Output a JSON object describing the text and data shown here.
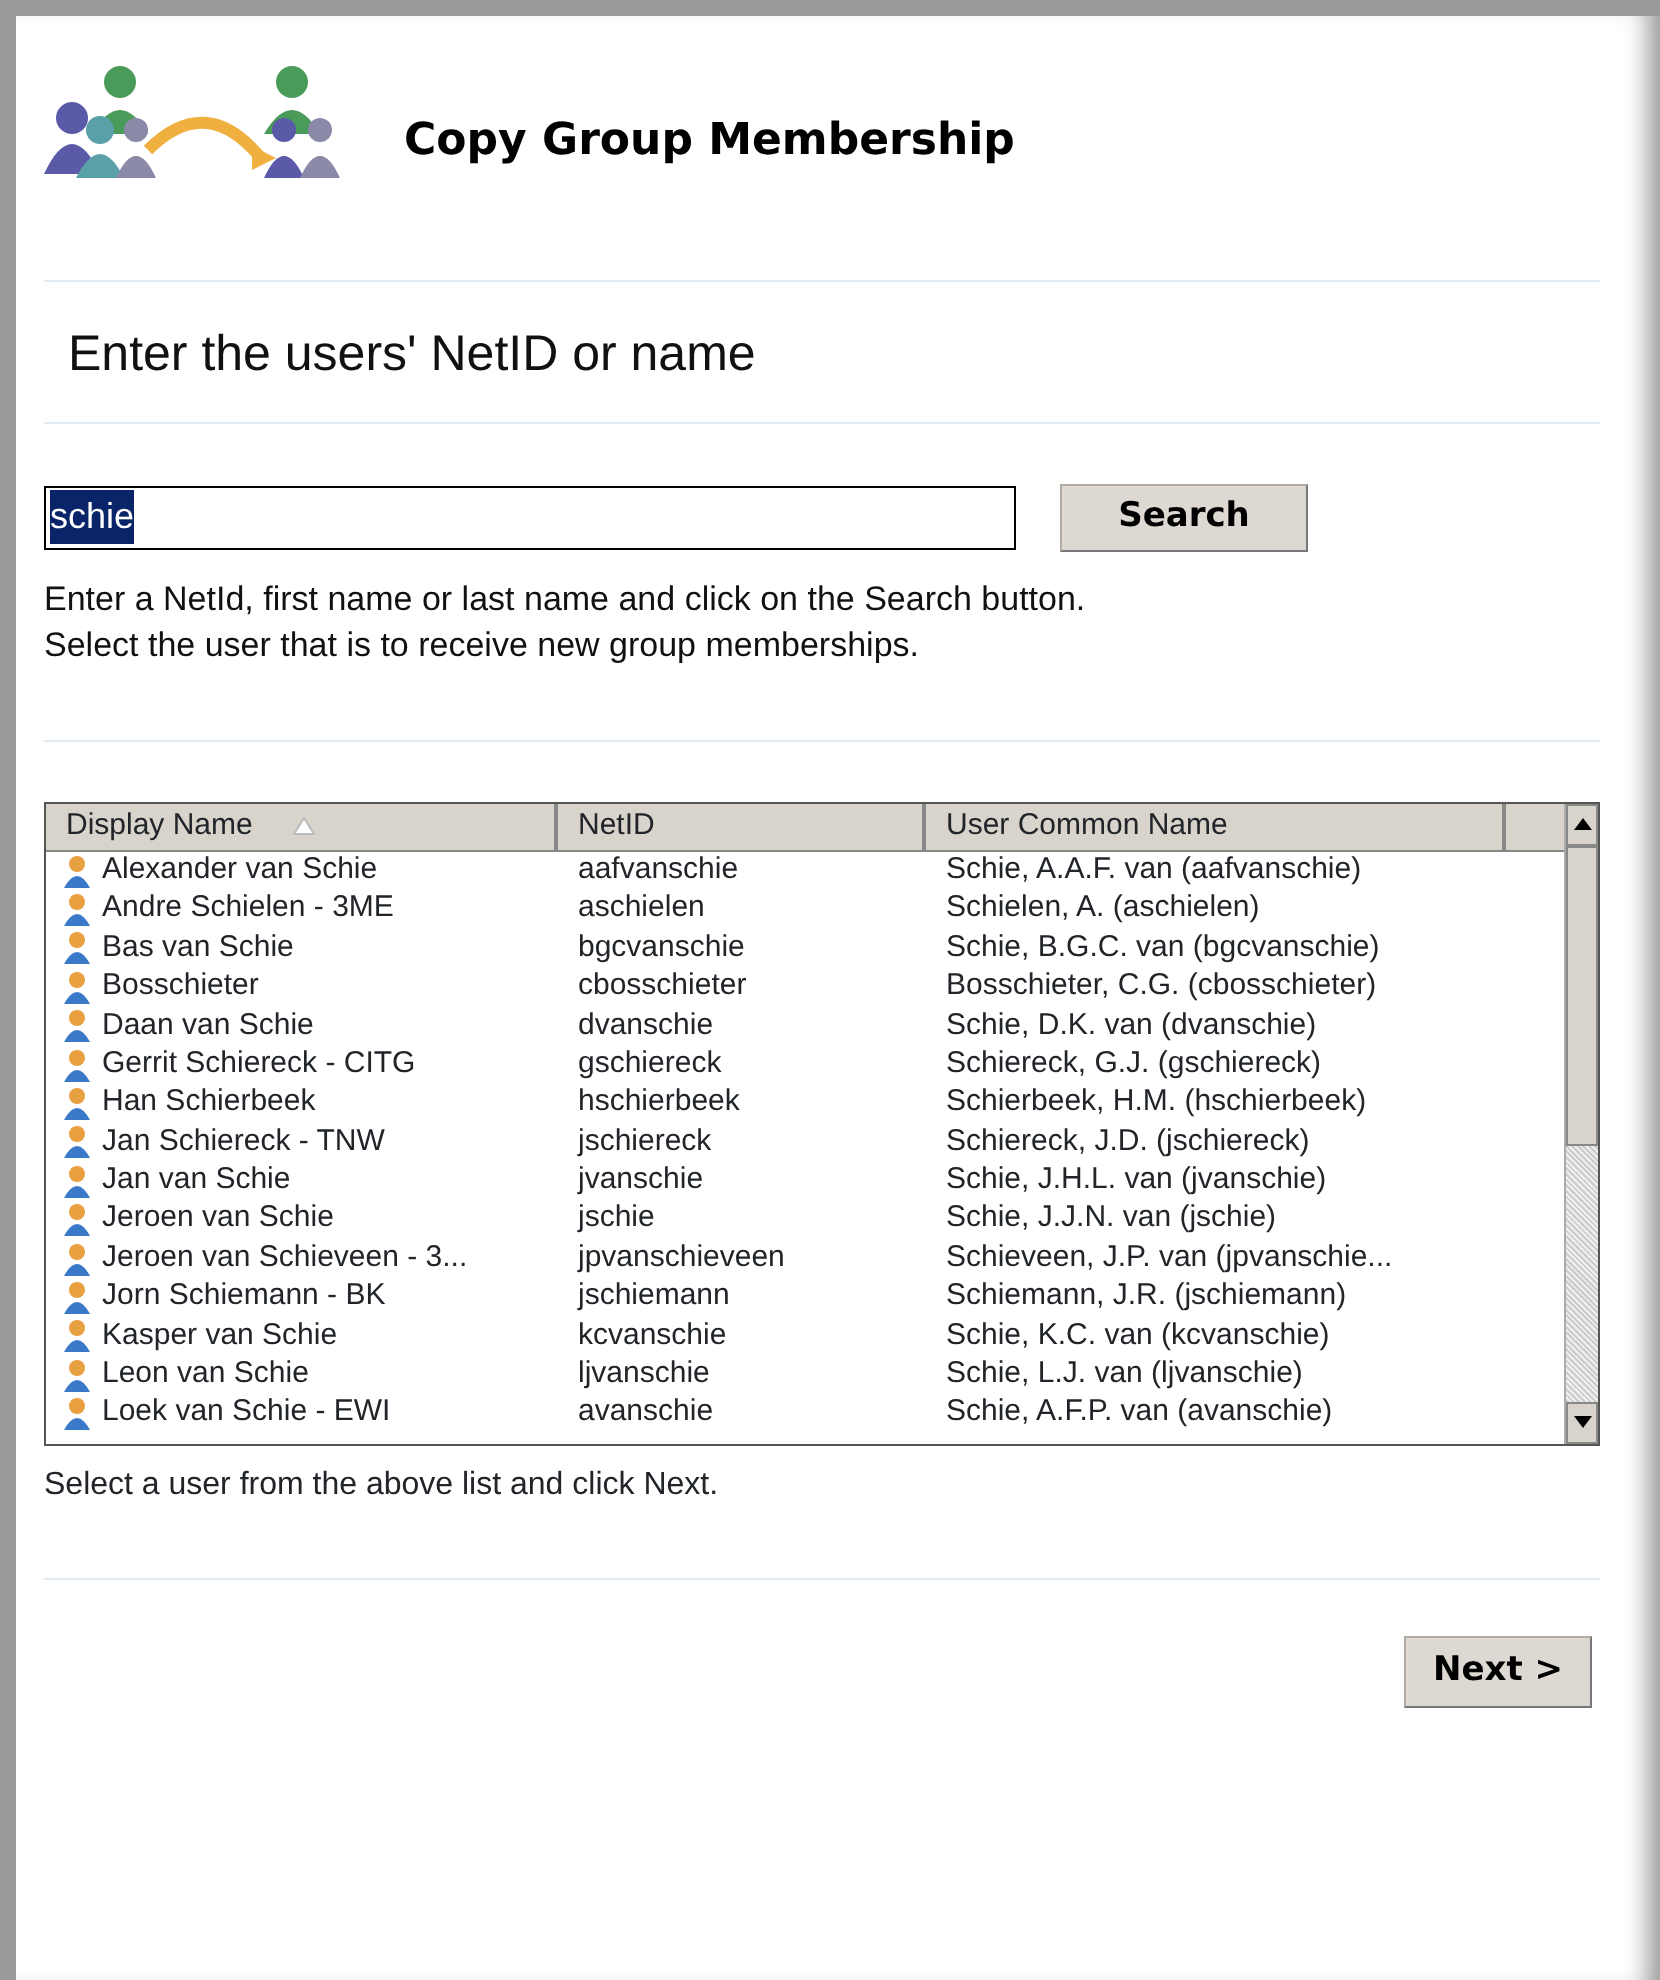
{
  "header": {
    "title": "Copy Group Membership"
  },
  "section_title": "Enter the users' NetID or name",
  "search": {
    "value": "schie",
    "text_selected": true,
    "button": "Search"
  },
  "instructions": [
    "Enter a NetId, first name or last name and click on the Search button.",
    "Select the user that is to receive new group memberships."
  ],
  "table": {
    "columns": [
      {
        "label": "Display Name",
        "sorted": true
      },
      {
        "label": "NetID",
        "sorted": false
      },
      {
        "label": "User Common Name",
        "sorted": false
      }
    ],
    "rows": [
      {
        "cells": [
          "Alexander van Schie",
          "aafvanschie",
          "Schie, A.A.F. van (aafvanschie)"
        ]
      },
      {
        "cells": [
          "Andre Schielen - 3ME",
          "aschielen",
          "Schielen, A. (aschielen)"
        ]
      },
      {
        "cells": [
          "Bas van Schie",
          "bgcvanschie",
          "Schie, B.G.C. van (bgcvanschie)"
        ]
      },
      {
        "cells": [
          "Bosschieter",
          "cbosschieter",
          "Bosschieter, C.G.  (cbosschieter)"
        ]
      },
      {
        "cells": [
          "Daan van Schie",
          "dvanschie",
          "Schie, D.K. van (dvanschie)"
        ]
      },
      {
        "cells": [
          "Gerrit Schiereck - CITG",
          "gschiereck",
          "Schiereck, G.J. (gschiereck)"
        ]
      },
      {
        "cells": [
          "Han Schierbeek",
          "hschierbeek",
          "Schierbeek, H.M. (hschierbeek)"
        ]
      },
      {
        "cells": [
          "Jan Schiereck - TNW",
          "jschiereck",
          "Schiereck, J.D. (jschiereck)"
        ]
      },
      {
        "cells": [
          "Jan van Schie",
          "jvanschie",
          "Schie, J.H.L. van (jvanschie)"
        ]
      },
      {
        "cells": [
          "Jeroen van Schie",
          "jschie",
          "Schie, J.J.N. van (jschie)"
        ]
      },
      {
        "cells": [
          "Jeroen van Schieveen - 3...",
          "jpvanschieveen",
          "Schieveen, J.P. van (jpvanschie..."
        ]
      },
      {
        "cells": [
          "Jorn Schiemann - BK",
          "jschiemann",
          "Schiemann, J.R. (jschiemann)"
        ]
      },
      {
        "cells": [
          "Kasper van Schie",
          "kcvanschie",
          "Schie, K.C. van (kcvanschie)"
        ]
      },
      {
        "cells": [
          "Leon van Schie",
          "ljvanschie",
          "Schie, L.J. van (ljvanschie)"
        ]
      },
      {
        "cells": [
          "Loek van Schie - EWI",
          "avanschie",
          "Schie, A.F.P. van (avanschie)"
        ]
      }
    ]
  },
  "footer_hint": "Select a user from the above list and click Next.",
  "next_button": "Next >"
}
